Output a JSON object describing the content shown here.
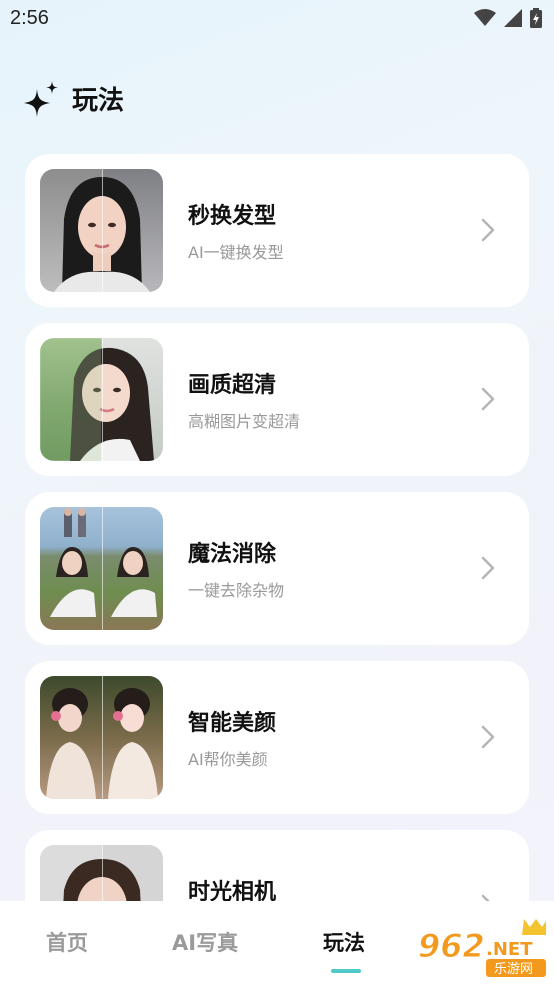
{
  "status": {
    "time": "2:56"
  },
  "header": {
    "title": "玩法",
    "icon": "sparkle-icon"
  },
  "cards": [
    {
      "title": "秒换发型",
      "subtitle": "AI一键换发型"
    },
    {
      "title": "画质超清",
      "subtitle": "高糊图片变超清"
    },
    {
      "title": "魔法消除",
      "subtitle": "一键去除杂物"
    },
    {
      "title": "智能美颜",
      "subtitle": "AI帮你美颜"
    },
    {
      "title": "时光相机",
      "subtitle": ""
    }
  ],
  "tabs": [
    {
      "label": "首页",
      "active": false
    },
    {
      "label": "AI写真",
      "active": false
    },
    {
      "label": "玩法",
      "active": true
    }
  ],
  "watermark": {
    "number": "962",
    "suffix": ".NET",
    "text": "乐游网"
  },
  "colors": {
    "accent": "#4fc9c9",
    "card_bg": "#ffffff",
    "subtitle": "#999999"
  }
}
